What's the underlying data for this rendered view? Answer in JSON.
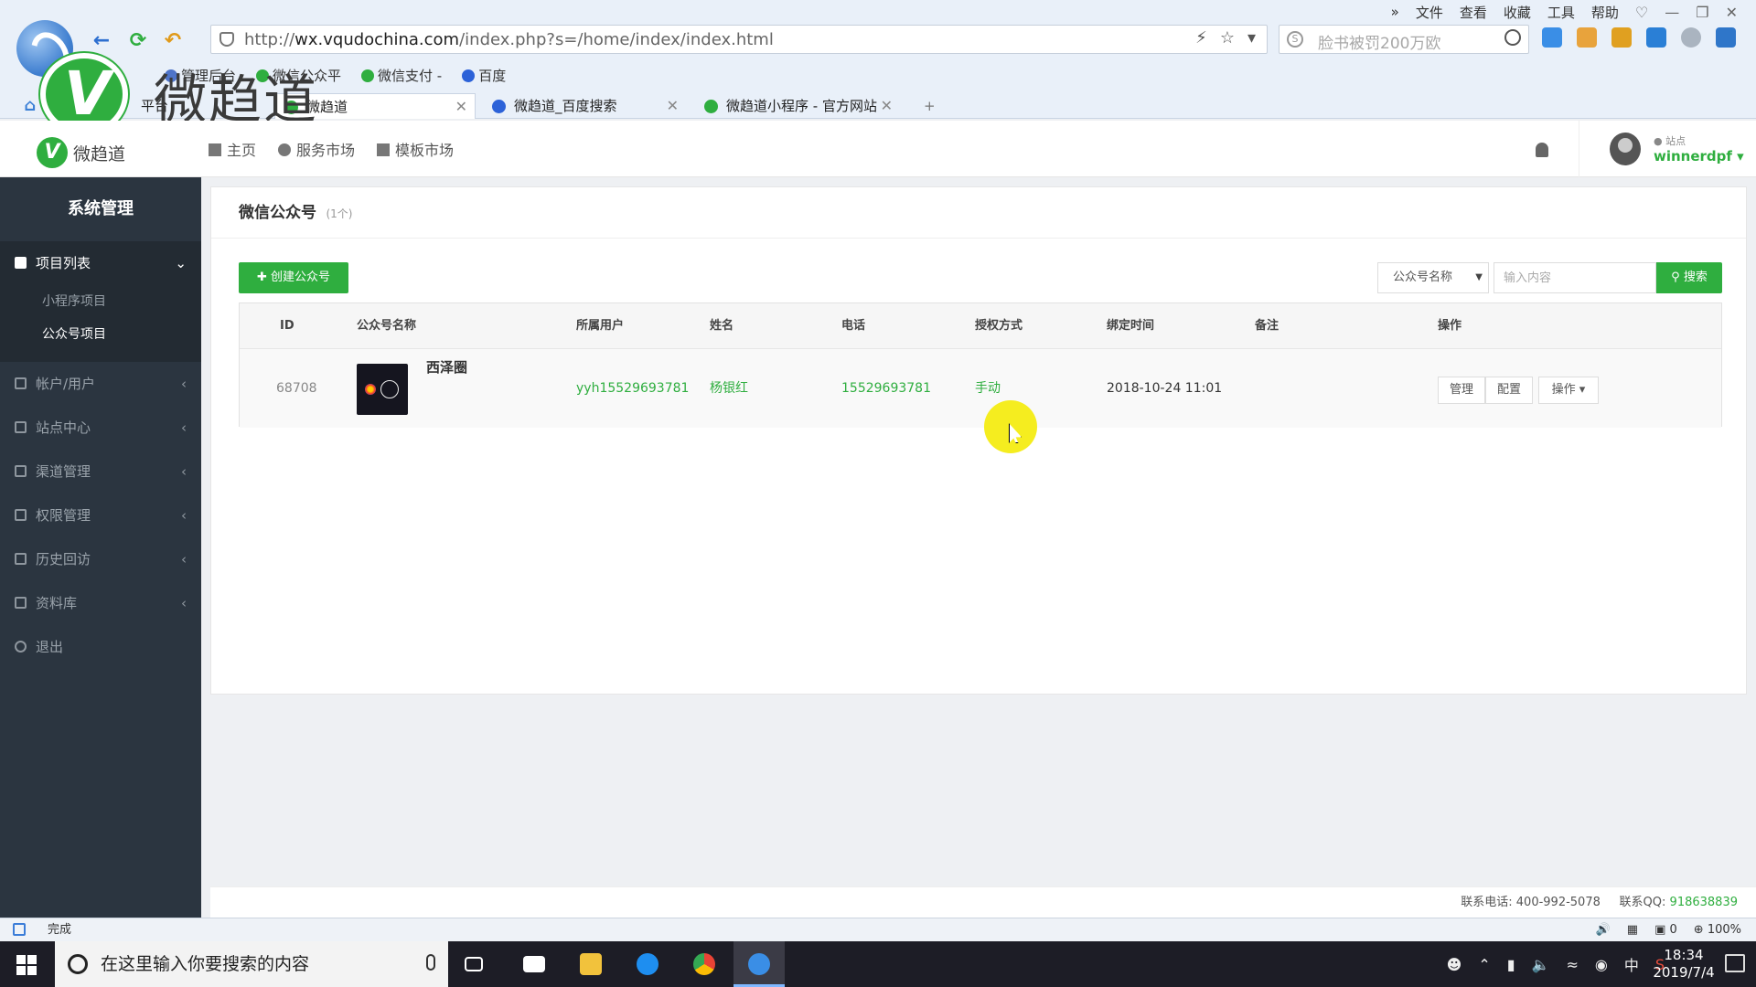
{
  "browser": {
    "menu": [
      "文件",
      "查看",
      "收藏",
      "工具",
      "帮助"
    ],
    "url_prefix": "http://",
    "url_domain": "wx.vqudochina.com",
    "url_path": "/index.php?s=/home/index/index.html",
    "search_placeholder": "脸书被罚200万欧",
    "bookmarks": [
      "管理后台",
      "微信公众平",
      "微信支付 -",
      "百度"
    ],
    "tabs": [
      {
        "title": "平台"
      },
      {
        "title": "微趋道"
      },
      {
        "title": "微趋道_百度搜索"
      },
      {
        "title": "微趋道小程序 - 官方网站"
      }
    ],
    "new_tab": "+",
    "status": "完成",
    "status_right": [
      "0",
      "100%"
    ]
  },
  "watermark": {
    "text": "微趋道"
  },
  "site": {
    "logo_text": "微趋道",
    "nav": [
      "主页",
      "服务市场",
      "模板市场"
    ],
    "user_role": "站点",
    "user_name": "winnerdpf"
  },
  "sidebar": {
    "title": "系统管理",
    "project_label": "项目列表",
    "sub_items": [
      "小程序项目",
      "公众号项目"
    ],
    "groups": [
      "帐户/用户",
      "站点中心",
      "渠道管理",
      "权限管理",
      "历史回访",
      "资料库",
      "退出"
    ]
  },
  "main": {
    "title": "微信公众号",
    "count": "(1个)",
    "create_button": "创建公众号",
    "filter_select": "公众号名称",
    "filter_placeholder": "输入内容",
    "search_button": "搜索",
    "columns": [
      "ID",
      "公众号名称",
      "所属用户",
      "姓名",
      "电话",
      "授权方式",
      "绑定时间",
      "备注",
      "操作"
    ],
    "row": {
      "id": "68708",
      "name": "西泽圈",
      "user": "yyh15529693781",
      "real_name": "杨银红",
      "phone": "15529693781",
      "auth": "手动",
      "bind_time": "2018-10-24 11:01",
      "remark": "",
      "ops": [
        "管理",
        "配置",
        "操作"
      ]
    }
  },
  "footer": {
    "phone_label": "联系电话:",
    "phone": "400-992-5078",
    "qq_label": "联系QQ:",
    "qq": "918638839"
  },
  "taskbar": {
    "search_placeholder": "在这里输入你要搜索的内容",
    "ime": "中",
    "time": "18:34",
    "date": "2019/7/4"
  },
  "colors": {
    "accent": "#2fae3f",
    "sidebar": "#2b3540"
  }
}
